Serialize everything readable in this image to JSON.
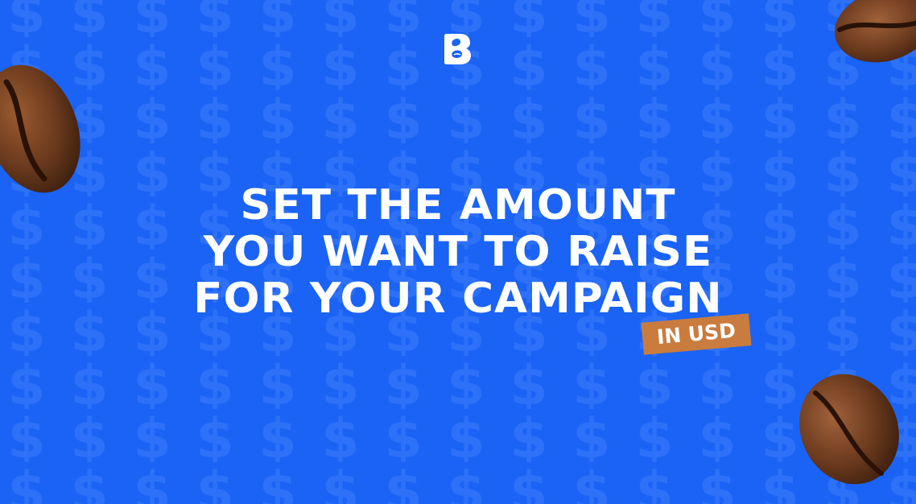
{
  "headline": {
    "line1": "SET THE AMOUNT",
    "line2": "YOU WANT TO RAISE",
    "line3": "FOR YOUR CAMPAIGN"
  },
  "badge": {
    "label": "IN USD"
  },
  "colors": {
    "background": "#1a63f5",
    "pattern": "#2b6ff7",
    "text": "#ffffff",
    "badge": "#c97c3e",
    "bean": "#6b3a1e"
  },
  "icons": {
    "logo": "letter-b-logo-icon",
    "pattern": "dollar-sign-icon",
    "decor": "coffee-bean-icon"
  }
}
